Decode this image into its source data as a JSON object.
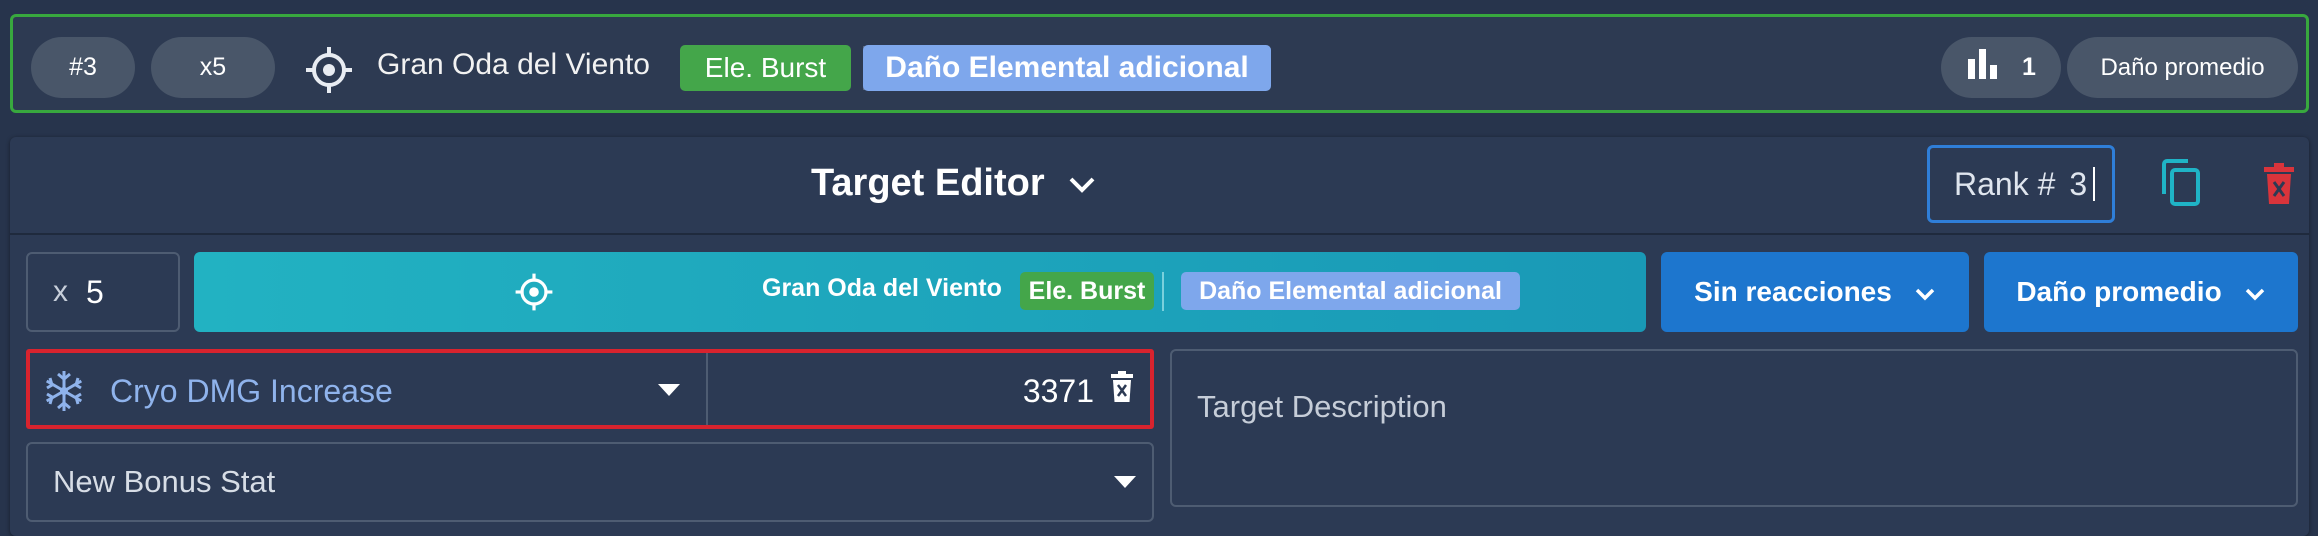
{
  "summary": {
    "rank_label": "#3",
    "multiplier_label": "x5",
    "target_name": "Gran Oda del Viento",
    "tag_burst": "Ele. Burst",
    "tag_extra": "Daño Elemental adicional",
    "count_value": "1",
    "mode_label": "Daño promedio"
  },
  "editor": {
    "title": "Target Editor",
    "rank_prefix": "Rank #",
    "rank_value": "3",
    "multiplier_prefix": "x",
    "multiplier_value": "5",
    "target": {
      "name": "Gran Oda del Viento",
      "tag_burst": "Ele. Burst",
      "tag_extra": "Daño Elemental adicional"
    },
    "reaction_select": "Sin reacciones",
    "damage_mode_select": "Daño promedio",
    "bonus_stat": {
      "label": "Cryo DMG Increase",
      "value": "3371"
    },
    "new_bonus_placeholder": "New Bonus Stat",
    "description_placeholder": "Target Description"
  },
  "colors": {
    "background": "#27344c",
    "active_outline": "#38a83e",
    "burst_tag": "#44a64a",
    "extra_tag": "#7ea7ec",
    "target_button": "#1ba6bd",
    "dropdown_button": "#1d76ce",
    "highlight_border": "#d8232e",
    "delete_red": "#d9343b",
    "copy_teal": "#1fb3c6",
    "cryo_label": "#8fb3ec"
  },
  "icons": {
    "target": "crosshair-icon",
    "stats": "bar-chart-icon",
    "expand": "chevron-down-icon",
    "copy": "copy-icon",
    "delete": "trash-icon",
    "cryo": "snowflake-icon"
  }
}
